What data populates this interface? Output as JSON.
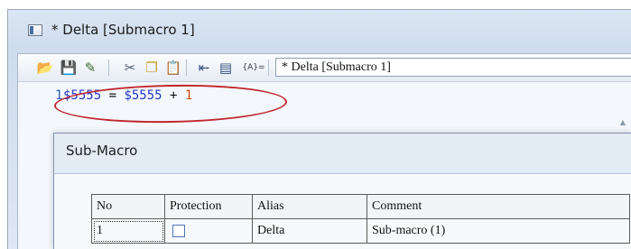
{
  "window": {
    "title": "* Delta [Submacro 1]"
  },
  "toolbar": {
    "icons": [
      "open-folder-icon",
      "save-icon",
      "edit-icon",
      "cut-icon",
      "copy-icon",
      "paste-icon",
      "outdent-icon",
      "properties-icon",
      "address-icon"
    ],
    "address_label": "{A}=",
    "combo_value": "* Delta [Submacro 1]"
  },
  "editor": {
    "line_number": "1",
    "code_var1": "$5555",
    "code_eq": " = ",
    "code_var2": "$5555",
    "code_plus": " + ",
    "code_num": "1",
    "highlight_color": "#c0262b"
  },
  "dialog": {
    "title": "Sub-Macro",
    "columns": [
      "No",
      "Protection",
      "Alias",
      "Comment"
    ],
    "rows": [
      {
        "no": "1",
        "protection": false,
        "alias": "Delta",
        "comment": "Sub-macro (1)"
      }
    ]
  }
}
